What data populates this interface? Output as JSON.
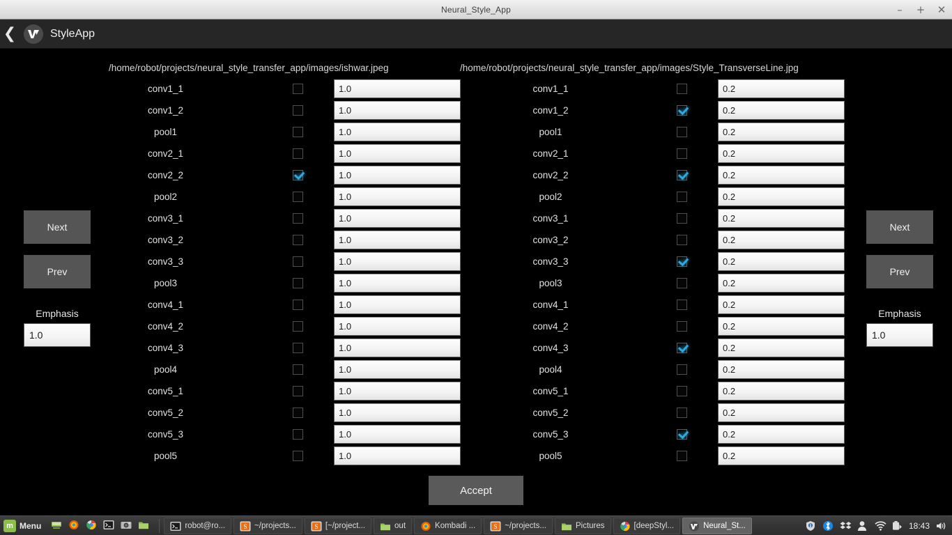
{
  "window": {
    "title": "Neural_Style_App",
    "controls": {
      "minimize": "–",
      "maximize": "+",
      "close": "✕"
    }
  },
  "appbar": {
    "back_icon": "❮",
    "logo_icon": "styleapp-logo-icon",
    "title": "StyleApp"
  },
  "panels": {
    "left": {
      "path": "/home/robot/projects/neural_style_transfer_app/images/ishwar.jpeg",
      "next_label": "Next",
      "prev_label": "Prev",
      "emphasis_label": "Emphasis",
      "emphasis_value": "1.0",
      "rows": [
        {
          "layer": "conv1_1",
          "checked": false,
          "weight": "1.0"
        },
        {
          "layer": "conv1_2",
          "checked": false,
          "weight": "1.0"
        },
        {
          "layer": "pool1",
          "checked": false,
          "weight": "1.0"
        },
        {
          "layer": "conv2_1",
          "checked": false,
          "weight": "1.0"
        },
        {
          "layer": "conv2_2",
          "checked": true,
          "weight": "1.0"
        },
        {
          "layer": "pool2",
          "checked": false,
          "weight": "1.0"
        },
        {
          "layer": "conv3_1",
          "checked": false,
          "weight": "1.0"
        },
        {
          "layer": "conv3_2",
          "checked": false,
          "weight": "1.0"
        },
        {
          "layer": "conv3_3",
          "checked": false,
          "weight": "1.0"
        },
        {
          "layer": "pool3",
          "checked": false,
          "weight": "1.0"
        },
        {
          "layer": "conv4_1",
          "checked": false,
          "weight": "1.0"
        },
        {
          "layer": "conv4_2",
          "checked": false,
          "weight": "1.0"
        },
        {
          "layer": "conv4_3",
          "checked": false,
          "weight": "1.0"
        },
        {
          "layer": "pool4",
          "checked": false,
          "weight": "1.0"
        },
        {
          "layer": "conv5_1",
          "checked": false,
          "weight": "1.0"
        },
        {
          "layer": "conv5_2",
          "checked": false,
          "weight": "1.0"
        },
        {
          "layer": "conv5_3",
          "checked": false,
          "weight": "1.0"
        },
        {
          "layer": "pool5",
          "checked": false,
          "weight": "1.0"
        }
      ]
    },
    "right": {
      "path": "/home/robot/projects/neural_style_transfer_app/images/Style_TransverseLine.jpg",
      "next_label": "Next",
      "prev_label": "Prev",
      "emphasis_label": "Emphasis",
      "emphasis_value": "1.0",
      "rows": [
        {
          "layer": "conv1_1",
          "checked": false,
          "weight": "0.2"
        },
        {
          "layer": "conv1_2",
          "checked": true,
          "weight": "0.2"
        },
        {
          "layer": "pool1",
          "checked": false,
          "weight": "0.2"
        },
        {
          "layer": "conv2_1",
          "checked": false,
          "weight": "0.2"
        },
        {
          "layer": "conv2_2",
          "checked": true,
          "weight": "0.2"
        },
        {
          "layer": "pool2",
          "checked": false,
          "weight": "0.2"
        },
        {
          "layer": "conv3_1",
          "checked": false,
          "weight": "0.2"
        },
        {
          "layer": "conv3_2",
          "checked": false,
          "weight": "0.2"
        },
        {
          "layer": "conv3_3",
          "checked": true,
          "weight": "0.2"
        },
        {
          "layer": "pool3",
          "checked": false,
          "weight": "0.2"
        },
        {
          "layer": "conv4_1",
          "checked": false,
          "weight": "0.2"
        },
        {
          "layer": "conv4_2",
          "checked": false,
          "weight": "0.2"
        },
        {
          "layer": "conv4_3",
          "checked": true,
          "weight": "0.2"
        },
        {
          "layer": "pool4",
          "checked": false,
          "weight": "0.2"
        },
        {
          "layer": "conv5_1",
          "checked": false,
          "weight": "0.2"
        },
        {
          "layer": "conv5_2",
          "checked": false,
          "weight": "0.2"
        },
        {
          "layer": "conv5_3",
          "checked": true,
          "weight": "0.2"
        },
        {
          "layer": "pool5",
          "checked": false,
          "weight": "0.2"
        }
      ]
    }
  },
  "accept_label": "Accept",
  "taskbar": {
    "menu_label": "Menu",
    "launchers": [
      {
        "name": "show-desktop-icon"
      },
      {
        "name": "firefox-icon"
      },
      {
        "name": "chrome-icon"
      },
      {
        "name": "terminal-icon"
      },
      {
        "name": "camera-icon"
      },
      {
        "name": "file-manager-icon"
      }
    ],
    "windows": [
      {
        "label": "robot@ro...",
        "icon": "terminal-icon",
        "active": false
      },
      {
        "label": "~/projects...",
        "icon": "sublime-icon",
        "active": false
      },
      {
        "label": "[~/project...",
        "icon": "sublime-icon",
        "active": false
      },
      {
        "label": "out",
        "icon": "folder-icon",
        "active": false
      },
      {
        "label": "Kombadi ...",
        "icon": "firefox-icon",
        "active": false
      },
      {
        "label": "~/projects...",
        "icon": "sublime-icon",
        "active": false
      },
      {
        "label": "Pictures",
        "icon": "folder-icon",
        "active": false
      },
      {
        "label": "[deepStyl...",
        "icon": "chrome-icon",
        "active": false
      },
      {
        "label": "Neural_St...",
        "icon": "styleapp-logo-icon",
        "active": true
      }
    ],
    "tray": [
      {
        "name": "shield-icon"
      },
      {
        "name": "bluetooth-icon"
      },
      {
        "name": "dropbox-icon"
      },
      {
        "name": "user-icon"
      },
      {
        "name": "wifi-icon"
      },
      {
        "name": "battery-icon"
      }
    ],
    "clock": "18:43",
    "volume_icon": "volume-icon"
  },
  "colors": {
    "checkbox_accent": "#29abe2",
    "button_bg": "#555555",
    "panel_bg": "#000000",
    "appbar_bg": "#262626"
  }
}
